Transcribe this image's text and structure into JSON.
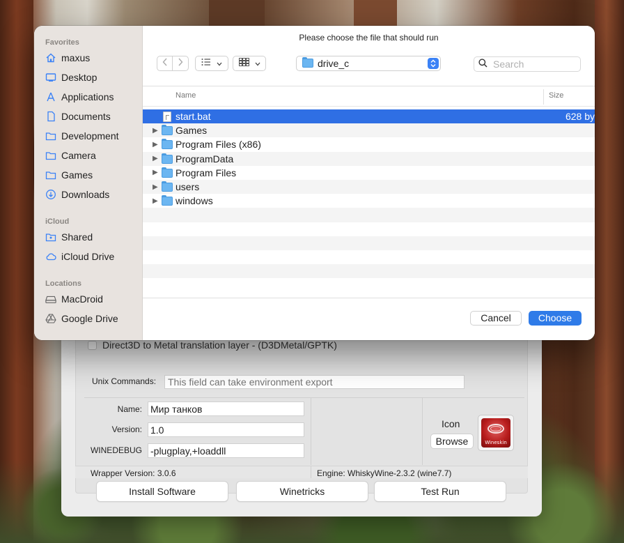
{
  "dialog": {
    "title": "Please choose the file that should run",
    "sidebar": {
      "favorites_label": "Favorites",
      "favorites": [
        {
          "label": "maxus",
          "icon": "home-icon"
        },
        {
          "label": "Desktop",
          "icon": "desktop-icon"
        },
        {
          "label": "Applications",
          "icon": "applications-icon"
        },
        {
          "label": "Documents",
          "icon": "document-icon"
        },
        {
          "label": "Development",
          "icon": "folder-icon"
        },
        {
          "label": "Camera",
          "icon": "folder-icon"
        },
        {
          "label": "Games",
          "icon": "folder-icon"
        },
        {
          "label": "Downloads",
          "icon": "downloads-icon"
        }
      ],
      "icloud_label": "iCloud",
      "icloud": [
        {
          "label": "Shared",
          "icon": "shared-folder-icon"
        },
        {
          "label": "iCloud Drive",
          "icon": "cloud-icon"
        }
      ],
      "locations_label": "Locations",
      "locations": [
        {
          "label": "MacDroid",
          "icon": "drive-icon"
        },
        {
          "label": "Google Drive",
          "icon": "google-drive-icon"
        }
      ]
    },
    "path": "drive_c",
    "search_placeholder": "Search",
    "columns": {
      "name": "Name",
      "size": "Size"
    },
    "files": [
      {
        "name": "start.bat",
        "type": "file",
        "size": "628 by",
        "selected": true
      },
      {
        "name": "Games",
        "type": "folder"
      },
      {
        "name": "Program Files (x86)",
        "type": "folder"
      },
      {
        "name": "ProgramData",
        "type": "folder"
      },
      {
        "name": "Program Files",
        "type": "folder"
      },
      {
        "name": "users",
        "type": "folder"
      },
      {
        "name": "windows",
        "type": "folder"
      }
    ],
    "cancel_label": "Cancel",
    "choose_label": "Choose"
  },
  "app": {
    "d3d_label": "Direct3D to Metal translation layer - (D3DMetal/GPTK)",
    "unix_label": "Unix Commands:",
    "unix_placeholder": "This field can take environment export",
    "name_label": "Name:",
    "name_value": "Мир танков",
    "version_label": "Version:",
    "version_value": "1.0",
    "winedebug_label": "WINEDEBUG",
    "winedebug_value": "-plugplay,+loaddll",
    "icon_label": "Icon",
    "browse_label": "Browse",
    "logo_text": "Wineskin",
    "wrapper_version": "Wrapper Version:   3.0.6",
    "engine": "Engine: WhiskyWine-2.3.2 (wine7.7)",
    "install_label": "Install Software",
    "winetricks_label": "Winetricks",
    "testrun_label": "Test Run"
  },
  "colors": {
    "accent": "#2f7be8",
    "selection": "#2f6fe4"
  }
}
